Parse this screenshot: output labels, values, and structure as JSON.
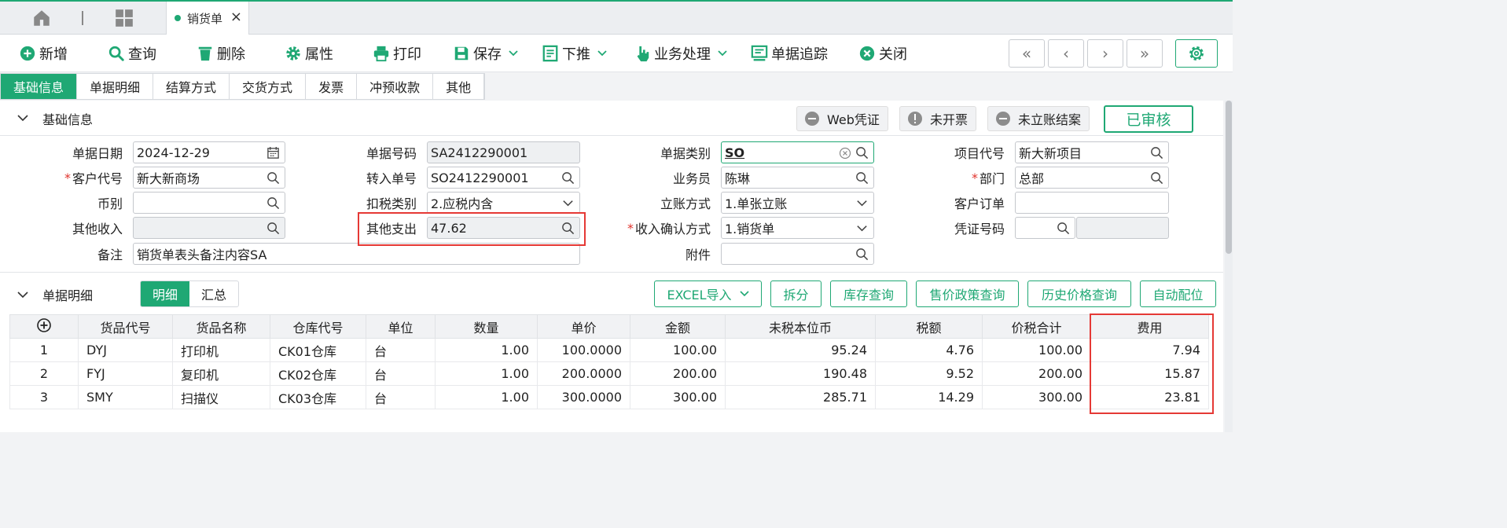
{
  "tab": {
    "label": "销货单",
    "close": "×"
  },
  "toolbar": {
    "new": "新增",
    "query": "查询",
    "delete": "删除",
    "properties": "属性",
    "print": "打印",
    "save": "保存",
    "push_down": "下推",
    "business_process": "业务处理",
    "doc_trace": "单据追踪",
    "close": "关闭"
  },
  "nav": {
    "first": "«",
    "prev": "‹",
    "next": "›",
    "last": "»"
  },
  "section_tabs": [
    "基础信息",
    "单据明细",
    "结算方式",
    "交货方式",
    "发票",
    "冲预收款",
    "其他"
  ],
  "basic": {
    "title": "基础信息",
    "badges": {
      "web_voucher": "Web凭证",
      "invoice": "未开票",
      "account": "未立账结案",
      "approved": "已审核"
    },
    "labels": {
      "doc_date": "单据日期",
      "customer_code": "客户代号",
      "currency": "币别",
      "other_income": "其他收入",
      "remark": "备注",
      "doc_no": "单据号码",
      "transfer_no": "转入单号",
      "tax_type": "扣税类别",
      "other_expense": "其他支出",
      "doc_category": "单据类别",
      "salesperson": "业务员",
      "account_method": "立账方式",
      "revenue_method": "收入确认方式",
      "attachment": "附件",
      "project_code": "项目代号",
      "department": "部门",
      "customer_order": "客户订单",
      "voucher_no": "凭证号码"
    },
    "values": {
      "doc_date": "2024-12-29",
      "customer_code": "新大新商场",
      "currency": "",
      "other_income": "",
      "remark": "销货单表头备注内容SA",
      "doc_no": "SA2412290001",
      "transfer_no": "SO2412290001",
      "tax_type": "2.应税内含",
      "other_expense": "47.62",
      "doc_category": "SO",
      "salesperson": "陈琳",
      "account_method": "1.单张立账",
      "revenue_method": "1.销货单",
      "attachment": "",
      "project_code": "新大新项目",
      "department": "总部",
      "customer_order": "",
      "voucher_no": ""
    },
    "required_mark": "*"
  },
  "detail": {
    "title": "单据明细",
    "views": [
      "明细",
      "汇总"
    ],
    "buttons": [
      "EXCEL导入",
      "拆分",
      "库存查询",
      "售价政策查询",
      "历史价格查询",
      "自动配位"
    ],
    "columns": [
      "货品代号",
      "货品名称",
      "仓库代号",
      "单位",
      "数量",
      "单价",
      "金额",
      "未税本位币",
      "税额",
      "价税合计",
      "费用"
    ],
    "rows": [
      [
        "1",
        "DYJ",
        "打印机",
        "CK01仓库",
        "台",
        "1.00",
        "100.0000",
        "100.00",
        "95.24",
        "4.76",
        "100.00",
        "7.94"
      ],
      [
        "2",
        "FYJ",
        "复印机",
        "CK02仓库",
        "台",
        "1.00",
        "200.0000",
        "200.00",
        "190.48",
        "9.52",
        "200.00",
        "15.87"
      ],
      [
        "3",
        "SMY",
        "扫描仪",
        "CK03仓库",
        "台",
        "1.00",
        "300.0000",
        "300.00",
        "285.71",
        "14.29",
        "300.00",
        "23.81"
      ]
    ]
  },
  "colors": {
    "accent": "#1fa874",
    "highlight": "#e53935"
  }
}
